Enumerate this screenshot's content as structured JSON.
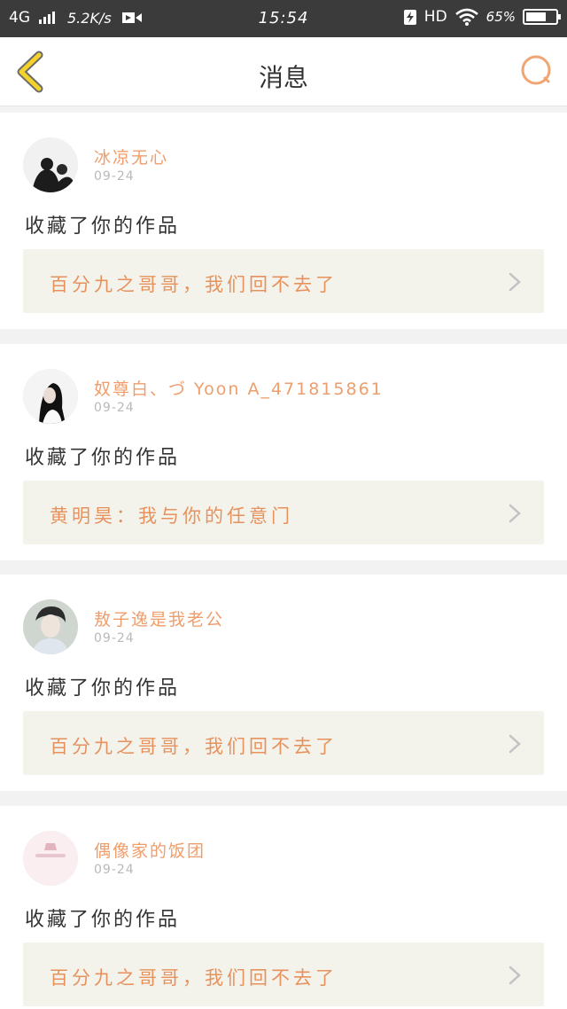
{
  "status_bar": {
    "network": "4G",
    "speed": "5.2K/s",
    "time": "15:54",
    "hd": "HD",
    "battery": "65%"
  },
  "navbar": {
    "title": "消息",
    "back_icon": "chevron-left-icon",
    "search_icon": "search-icon"
  },
  "colors": {
    "accent": "#ee9e6c",
    "back_yellow": "#f5d22a",
    "card_work_bg": "#f3f3ec"
  },
  "messages": [
    {
      "username": "冰凉无心",
      "date": "09-24",
      "action": "收藏了你的作品",
      "work_title": "百分九之哥哥，我们回不去了"
    },
    {
      "username": "奴尊白、づ Yoon A_471815861",
      "date": "09-24",
      "action": "收藏了你的作品",
      "work_title": "黄明昊：我与你的任意门"
    },
    {
      "username": "敖子逸是我老公",
      "date": "09-24",
      "action": "收藏了你的作品",
      "work_title": "百分九之哥哥，我们回不去了"
    },
    {
      "username": "偶像家的饭团",
      "date": "09-24",
      "action": "收藏了你的作品",
      "work_title": "百分九之哥哥，我们回不去了"
    }
  ]
}
